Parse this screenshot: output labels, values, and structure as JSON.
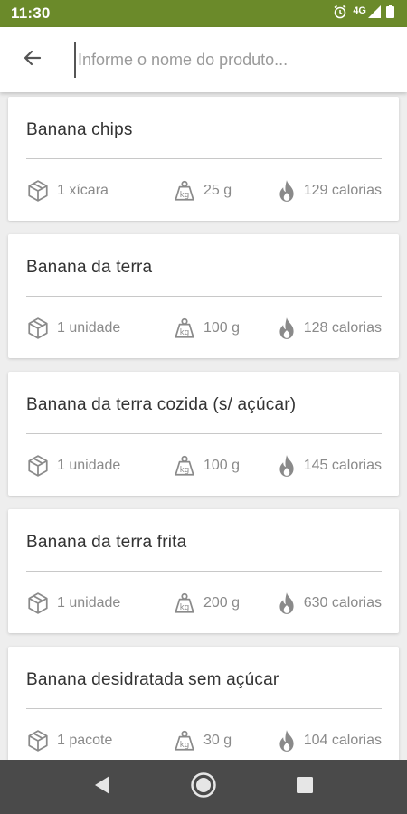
{
  "status_bar": {
    "time": "11:30",
    "network": "4G"
  },
  "search": {
    "placeholder": "Informe o nome do produto..."
  },
  "products": [
    {
      "name": "Banana chips",
      "portion": "1 xícara",
      "weight": "25 g",
      "calories": "129 calorias"
    },
    {
      "name": "Banana da terra",
      "portion": "1 unidade",
      "weight": "100 g",
      "calories": "128 calorias"
    },
    {
      "name": "Banana da terra cozida (s/ açúcar)",
      "portion": "1 unidade",
      "weight": "100 g",
      "calories": "145 calorias"
    },
    {
      "name": "Banana da terra frita",
      "portion": "1 unidade",
      "weight": "200 g",
      "calories": "630 calorias"
    },
    {
      "name": "Banana desidratada sem açúcar",
      "portion": "1 pacote",
      "weight": "30 g",
      "calories": "104 calorias"
    }
  ],
  "icons": {
    "portion": "box-icon",
    "weight": "weight-icon",
    "calories": "flame-icon"
  },
  "colors": {
    "status_bar": "#6b8a2a",
    "nav_bar": "#4a4a4a",
    "background": "#eeeeee",
    "card": "#ffffff",
    "text": "#333333",
    "muted": "#8a8a8a"
  }
}
